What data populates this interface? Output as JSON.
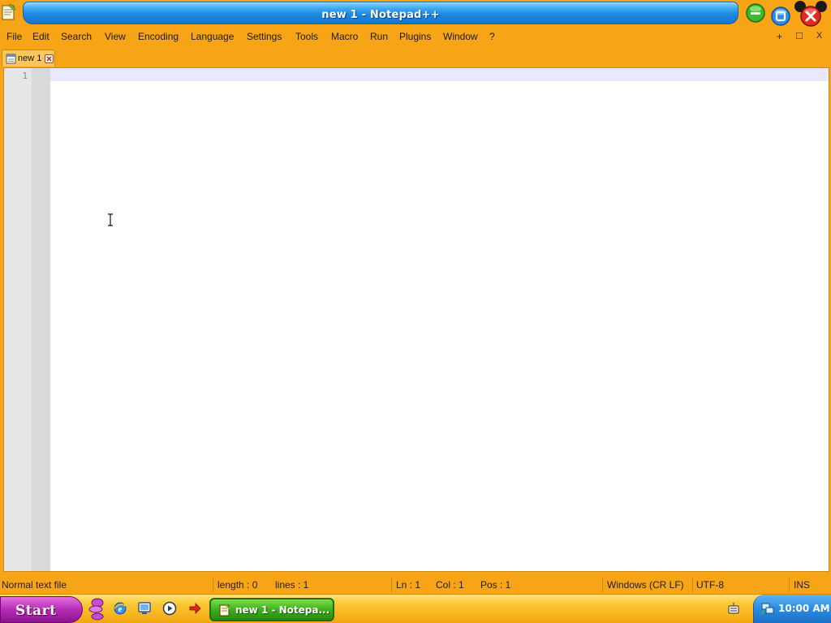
{
  "window": {
    "title": "new 1 - Notepad++"
  },
  "menu": {
    "items": [
      {
        "label": "File"
      },
      {
        "label": "Edit"
      },
      {
        "label": "Search"
      },
      {
        "label": "View"
      },
      {
        "label": "Encoding"
      },
      {
        "label": "Language"
      },
      {
        "label": "Settings"
      },
      {
        "label": "Tools"
      },
      {
        "label": "Macro"
      },
      {
        "label": "Run"
      },
      {
        "label": "Plugins"
      },
      {
        "label": "Window"
      },
      {
        "label": "?"
      }
    ],
    "doc_buttons": {
      "new": "+",
      "restore": "□",
      "close": "X"
    }
  },
  "tabs": [
    {
      "label": "new 1",
      "active": true
    }
  ],
  "editor": {
    "line_numbers": [
      "1"
    ],
    "content": ""
  },
  "status": {
    "file_type": "Normal text file",
    "length": "length : 0",
    "lines": "lines : 1",
    "ln": "Ln : 1",
    "col": "Col : 1",
    "pos": "Pos : 1",
    "eol": "Windows (CR LF)",
    "encoding": "UTF-8",
    "mode": "INS"
  },
  "taskbar": {
    "start_label": "Start",
    "quick_launch_icons": [
      "butterfly-icon",
      "internet-explorer-icon",
      "desktop-icon",
      "media-player-icon",
      "arrow-icon"
    ],
    "task_label": "new 1 - Notepa...",
    "tray_icons": [
      "keyboard-icon",
      "network-icon"
    ],
    "clock": "10:00 AM"
  },
  "colors": {
    "chrome_orange": "#f7a417",
    "title_blue": "#1a86e0",
    "start_purple": "#b52db4",
    "task_green": "#3fb01c",
    "tray_blue": "#2a8be0"
  }
}
